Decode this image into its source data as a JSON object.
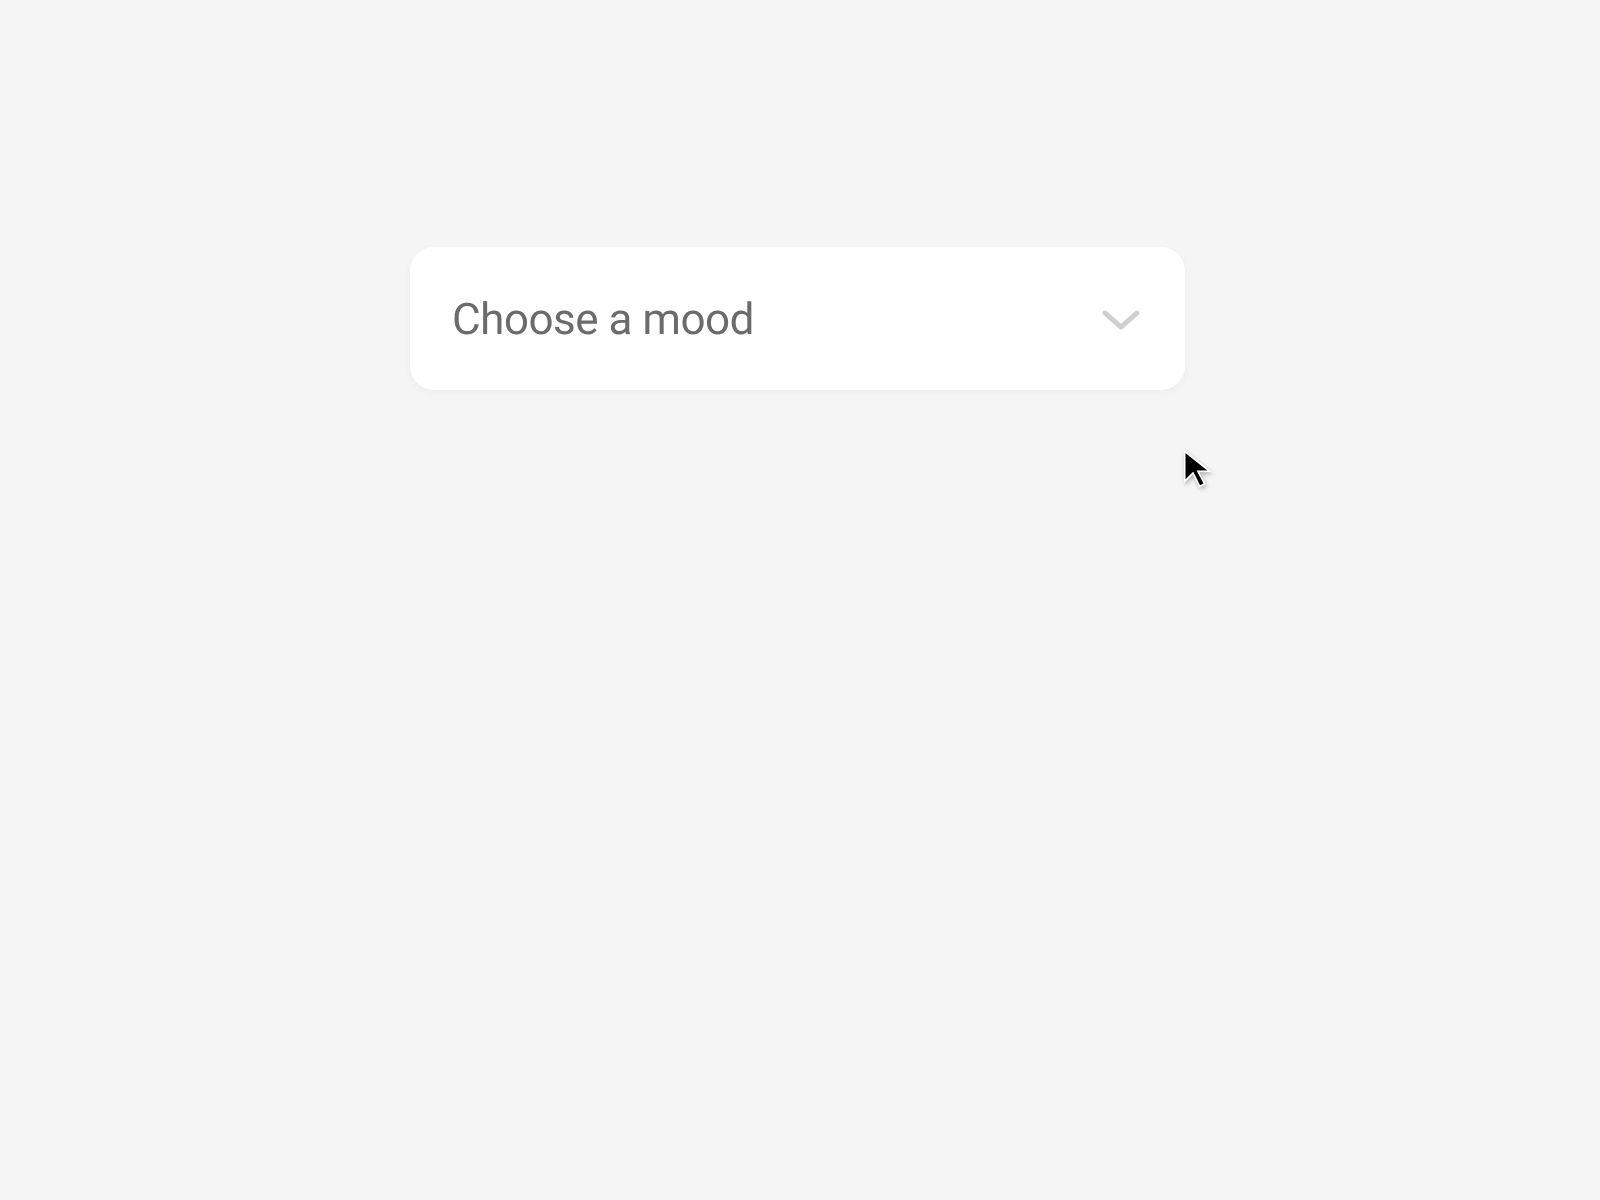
{
  "dropdown": {
    "placeholder": "Choose a mood"
  },
  "icons": {
    "chevron": "chevron-down-icon",
    "cursor": "cursor-icon"
  },
  "colors": {
    "background": "#f5f5f5",
    "card": "#ffffff",
    "text": "#6b6b6b",
    "chevron": "#cfcfcf"
  }
}
